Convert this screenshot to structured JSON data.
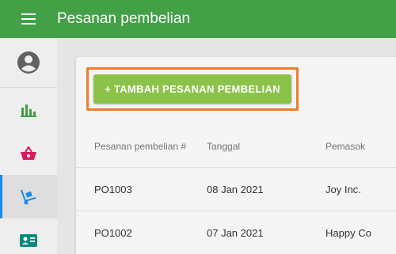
{
  "app": {
    "title": "Pesanan pembelian",
    "header_color": "#43a047"
  },
  "icons": {
    "menu": "hamburger-menu-icon",
    "account": "account-circle-icon",
    "reports": "bar-chart-icon",
    "sales": "basket-icon",
    "purchases": "hand-truck-icon",
    "contacts": "contact-card-icon"
  },
  "sidebar": {
    "active_item": "purchases",
    "accent": "#1e88e5"
  },
  "toolbar": {
    "add_label": "+ TAMBAH PESANAN PEMBELIAN",
    "add_color": "#8bc34a",
    "focus_color": "#ef7d2a"
  },
  "table": {
    "columns": [
      "Pesanan pembelian #",
      "Tanggal",
      "Pemasok"
    ],
    "rows": [
      {
        "id": "PO1003",
        "date": "08 Jan 2021",
        "supplier": "Joy Inc."
      },
      {
        "id": "PO1002",
        "date": "07 Jan 2021",
        "supplier": "Happy Co"
      }
    ]
  }
}
